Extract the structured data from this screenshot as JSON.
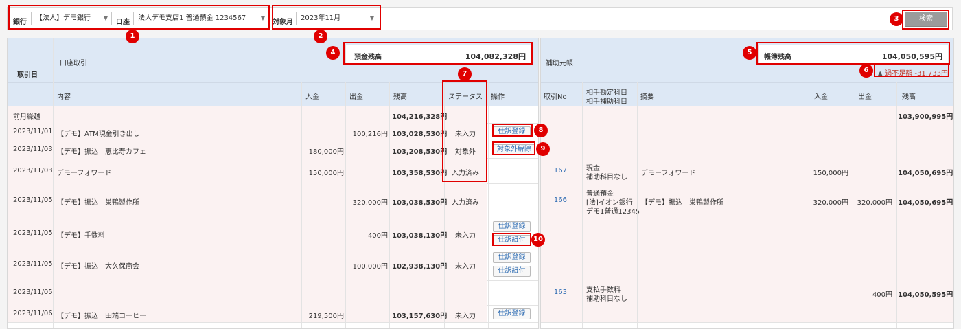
{
  "filters": {
    "bank_label": "銀行",
    "bank_value": "【法人】デモ銀行",
    "account_label": "口座",
    "account_value": "法人デモ支店1 普通預金 1234567",
    "month_label": "対象月",
    "month_value": "2023年11月",
    "search_label": "検索"
  },
  "annotations": [
    "1",
    "2",
    "3",
    "4",
    "5",
    "6",
    "7",
    "8",
    "9",
    "10"
  ],
  "bank_panel": {
    "date_header": "取引日",
    "section_title": "口座取引",
    "balance_label": "預金残高",
    "balance_value": "104,082,328円",
    "columns": {
      "desc": "内容",
      "deposit": "入金",
      "withdraw": "出金",
      "balance": "残高",
      "status": "ステータス",
      "action": "操作"
    }
  },
  "ledger_panel": {
    "section_title": "補助元帳",
    "balance_label": "帳簿残高",
    "balance_value": "104,050,595円",
    "warning": "過不足額 -31,733円",
    "columns": {
      "no": "取引No",
      "account1": "相手勘定科目",
      "account2": "相手補助科目",
      "summary": "摘要",
      "deposit": "入金",
      "withdraw": "出金",
      "balance": "残高"
    }
  },
  "rows": [
    {
      "date": "前月繰越",
      "desc": "",
      "deposit": "",
      "withdraw": "",
      "balance": "104,216,328円",
      "status": "",
      "actions": [],
      "l_no": "",
      "l_acc1": "",
      "l_acc2": "",
      "l_acc3": "",
      "l_summary": "",
      "l_deposit": "",
      "l_withdraw": "",
      "l_balance": "103,900,995円"
    },
    {
      "date": "2023/11/01",
      "desc": "【デモ】ATM現金引き出し",
      "deposit": "",
      "withdraw": "100,216円",
      "balance": "103,028,530円",
      "status": "未入力",
      "actions": [
        "仕訳登録"
      ],
      "l_no": "",
      "l_acc1": "",
      "l_acc2": "",
      "l_acc3": "",
      "l_summary": "",
      "l_deposit": "",
      "l_withdraw": "",
      "l_balance": ""
    },
    {
      "date": "2023/11/03",
      "desc": "【デモ】振込　恵比寿カフェ",
      "deposit": "180,000円",
      "withdraw": "",
      "balance": "103,208,530円",
      "status": "対象外",
      "actions": [
        "対象外解除"
      ],
      "l_no": "",
      "l_acc1": "",
      "l_acc2": "",
      "l_acc3": "",
      "l_summary": "",
      "l_deposit": "",
      "l_withdraw": "",
      "l_balance": ""
    },
    {
      "date": "2023/11/03",
      "desc": "デモーフォワード",
      "deposit": "150,000円",
      "withdraw": "",
      "balance": "103,358,530円",
      "status": "入力済み",
      "actions": [],
      "l_no": "167",
      "l_acc1": "現金",
      "l_acc2": "補助科目なし",
      "l_acc3": "",
      "l_summary": "デモーフォワード",
      "l_deposit": "150,000円",
      "l_withdraw": "",
      "l_balance": "104,050,695円"
    },
    {
      "date": "2023/11/05",
      "desc": "【デモ】振込　巣鴨製作所",
      "deposit": "",
      "withdraw": "320,000円",
      "balance": "103,038,530円",
      "status": "入力済み",
      "actions": [],
      "l_no": "166",
      "l_acc1": "普通預金",
      "l_acc2": "[法]イオン銀行",
      "l_acc3": "デモ1普通12345",
      "l_summary": "【デモ】振込　巣鴨製作所",
      "l_deposit": "320,000円",
      "l_withdraw": "320,000円",
      "l_balance": "104,050,695円"
    },
    {
      "date": "2023/11/05",
      "desc": "【デモ】手数料",
      "deposit": "",
      "withdraw": "400円",
      "balance": "103,038,130円",
      "status": "未入力",
      "actions": [
        "仕訳登録",
        "仕訳紐付"
      ],
      "l_no": "",
      "l_acc1": "",
      "l_acc2": "",
      "l_acc3": "",
      "l_summary": "",
      "l_deposit": "",
      "l_withdraw": "",
      "l_balance": ""
    },
    {
      "date": "2023/11/05",
      "desc": "【デモ】振込　大久保商会",
      "deposit": "",
      "withdraw": "100,000円",
      "balance": "102,938,130円",
      "status": "未入力",
      "actions": [
        "仕訳登録",
        "仕訳紐付"
      ],
      "l_no": "",
      "l_acc1": "",
      "l_acc2": "",
      "l_acc3": "",
      "l_summary": "",
      "l_deposit": "",
      "l_withdraw": "",
      "l_balance": ""
    },
    {
      "date": "2023/11/05",
      "desc": "",
      "deposit": "",
      "withdraw": "",
      "balance": "",
      "status": "",
      "actions": [],
      "l_no": "163",
      "l_acc1": "支払手数料",
      "l_acc2": "補助科目なし",
      "l_acc3": "",
      "l_summary": "",
      "l_deposit": "",
      "l_withdraw": "400円",
      "l_balance": "104,050,595円"
    },
    {
      "date": "2023/11/06",
      "desc": "【デモ】振込　田端コーヒー",
      "deposit": "219,500円",
      "withdraw": "",
      "balance": "103,157,630円",
      "status": "未入力",
      "actions": [
        "仕訳登録"
      ],
      "l_no": "",
      "l_acc1": "",
      "l_acc2": "",
      "l_acc3": "",
      "l_summary": "",
      "l_deposit": "",
      "l_withdraw": "",
      "l_balance": ""
    }
  ]
}
